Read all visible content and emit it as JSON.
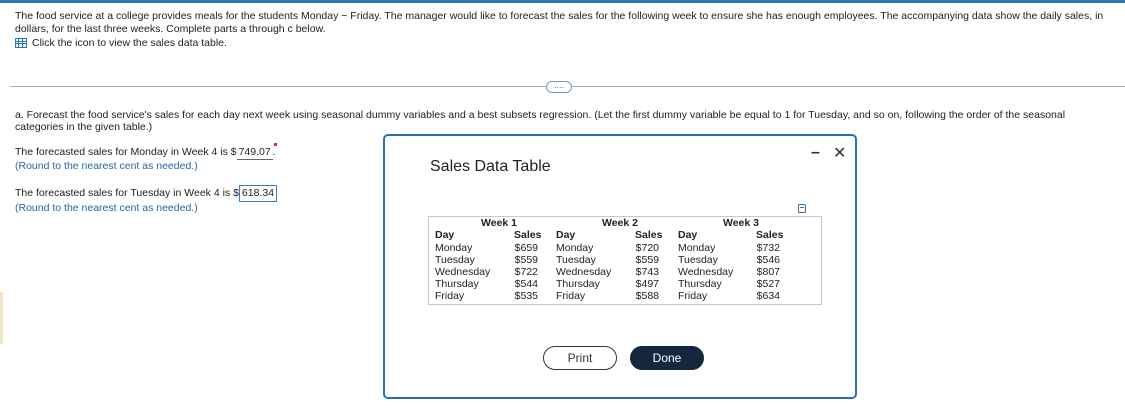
{
  "intro": {
    "text": "The food service at a college provides meals for the students Monday − Friday. The manager would like to forecast the sales for the following week to ensure she has enough employees. The accompanying data show the daily sales, in dollars, for the last three weeks. Complete parts a through c below.",
    "link": "Click the icon to view the sales data table."
  },
  "question": {
    "text": "a. Forecast the food service's sales for each day next week using seasonal dummy variables and a best subsets regression. (Let the first dummy variable be equal to 1 for Tuesday, and so on, following the order of the seasonal categories in the given table.)"
  },
  "answers": [
    {
      "prefix": "The forecasted sales for Monday in Week 4 is $",
      "value": "749.07",
      "suffix": ".",
      "note": "(Round to the nearest cent as needed.)"
    },
    {
      "prefix": "The forecasted sales for Tuesday in Week 4 is $",
      "value": "618.34",
      "suffix": "",
      "note": "(Round to the nearest cent as needed.)"
    }
  ],
  "dialog": {
    "title": "Sales Data Table",
    "min_symbol": "–",
    "close_symbol": "✕",
    "print_label": "Print",
    "done_label": "Done",
    "ellipsis": "....",
    "weeks": [
      {
        "title": "Week 1",
        "day_header": "Day",
        "sales_header": "Sales",
        "rows": [
          [
            "Monday",
            "$659"
          ],
          [
            "Tuesday",
            "$559"
          ],
          [
            "Wednesday",
            "$722"
          ],
          [
            "Thursday",
            "$544"
          ],
          [
            "Friday",
            "$535"
          ]
        ]
      },
      {
        "title": "Week 2",
        "day_header": "Day",
        "sales_header": "Sales",
        "rows": [
          [
            "Monday",
            "$720"
          ],
          [
            "Tuesday",
            "$559"
          ],
          [
            "Wednesday",
            "$743"
          ],
          [
            "Thursday",
            "$497"
          ],
          [
            "Friday",
            "$588"
          ]
        ]
      },
      {
        "title": "Week 3",
        "day_header": "Day",
        "sales_header": "Sales",
        "rows": [
          [
            "Monday",
            "$732"
          ],
          [
            "Tuesday",
            "$546"
          ],
          [
            "Wednesday",
            "$807"
          ],
          [
            "Thursday",
            "$527"
          ],
          [
            "Friday",
            "$634"
          ]
        ]
      }
    ]
  },
  "colors": {
    "accent": "#2a6fb0",
    "done_button": "#14273e",
    "hint_text": "#2a64a8"
  },
  "icons": {
    "table": "table-icon",
    "copy": "copy-icon",
    "close": "close-icon",
    "minimize": "minimize-icon"
  }
}
